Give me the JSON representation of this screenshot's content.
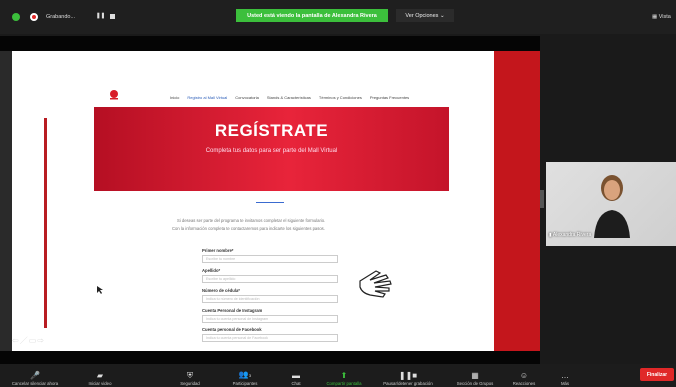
{
  "topbar": {
    "recording_label": "Grabando...",
    "share_banner": "Usted está viendo la pantalla de Alexandra Rivera",
    "view_options": "Ver Opciones",
    "view_label": "Vista"
  },
  "website": {
    "nav": [
      "Inicio",
      "Registro al Mall Virtual",
      "Convocatoria",
      "Stands & Características",
      "Términos y Condiciones",
      "Preguntas Frecuentes"
    ],
    "hero_title": "REGÍSTRATE",
    "hero_subtitle": "Completa tus datos para ser parte del Mall Virtual",
    "intro_line1": "Si deseas ser parte del programa te invitamos completar el siguiente formulario.",
    "intro_line2": "Con la información completa te contactaremos para indicarte los siguientes pasos.",
    "fields": [
      {
        "label": "Primer nombre*",
        "placeholder": "Escribe tu nombre"
      },
      {
        "label": "Apellido*",
        "placeholder": "Escribe tu apellido"
      },
      {
        "label": "Número de cédula*",
        "placeholder": "Indica tu número de identificación"
      },
      {
        "label": "Cuenta Personal de Instagram",
        "placeholder": "Indica tu cuenta personal de Instagram"
      },
      {
        "label": "Cuenta personal de Facebook",
        "placeholder": "Indica tu cuenta personal de Facebook"
      }
    ]
  },
  "participant": {
    "name": "Alexandra Rivera"
  },
  "toolbar": {
    "items": [
      "Cancelar silenciar ahora",
      "Iniciar video",
      "Seguridad",
      "Participantes",
      "Chat",
      "Compartir pantalla",
      "Pausar/detener grabación",
      "Sección de Grupos",
      "Reacciones",
      "Más"
    ],
    "participants_count": "3",
    "end_button": "Finalizar"
  },
  "colors": {
    "accent_green": "#3cbf3c",
    "brand_red": "#c4161c",
    "end_red": "#e02828"
  }
}
